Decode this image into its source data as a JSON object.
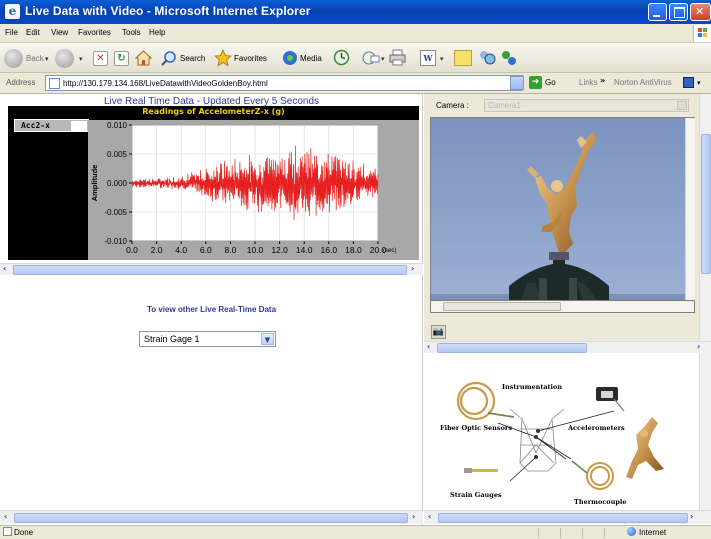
{
  "window": {
    "title": "Live Data with Video - Microsoft Internet Explorer"
  },
  "menu": [
    "File",
    "Edit",
    "View",
    "Favorites",
    "Tools",
    "Help"
  ],
  "toolbar": {
    "back": "Back",
    "search": "Search",
    "favorites": "Favorites",
    "media": "Media"
  },
  "address": {
    "label": "Address",
    "url": "http://130.179.134.168/LiveDatawithVideoGoldenBoy.html",
    "go": "Go",
    "links": "Links",
    "norton": "Norton AntiVirus"
  },
  "left": {
    "heading": "Live Real Time Data - Updated Every 5 Seconds",
    "other_data_label": "To view other Live Real-Time Data",
    "select_value": "Strain Gage 1"
  },
  "chart_data": {
    "type": "line",
    "title": "Readings of AccelometerZ-x (g)",
    "legend": "Acc2-x",
    "ylabel": "Amplitude",
    "xlabel": "(sec)",
    "xlim": [
      0,
      20
    ],
    "ylim": [
      -0.01,
      0.01
    ],
    "x_ticks": [
      "0.0",
      "2.0",
      "4.0",
      "6.0",
      "8.0",
      "10.0",
      "12.0",
      "14.0",
      "16.0",
      "18.0",
      "20.0"
    ],
    "y_ticks": [
      "0.010",
      "0.005",
      "0.000",
      "-0.005",
      "-0.010"
    ],
    "grid": true,
    "series": [
      {
        "name": "Acc2-x",
        "color": "#e62020",
        "envelope": [
          {
            "x": 0,
            "amp": 0.0007
          },
          {
            "x": 4,
            "amp": 0.0012
          },
          {
            "x": 6,
            "amp": 0.003
          },
          {
            "x": 10,
            "amp": 0.005
          },
          {
            "x": 14,
            "amp": 0.0065
          },
          {
            "x": 17,
            "amp": 0.0045
          },
          {
            "x": 20,
            "amp": 0.0025
          }
        ]
      }
    ]
  },
  "right": {
    "camera_label": "Camera :",
    "camera_value": "Camera1",
    "instrumentation": {
      "title": "Instrumentation",
      "fiber": "Fiber Optic Sensors",
      "accel": "Accelerometers",
      "strain": "Strain Gauges",
      "thermo": "Thermocouple"
    }
  },
  "status": {
    "text": "Done",
    "zone": "Internet"
  },
  "colors": {
    "title_bar": "#0842b4",
    "heading": "#2f3b9c",
    "plot_line": "#e62020"
  }
}
